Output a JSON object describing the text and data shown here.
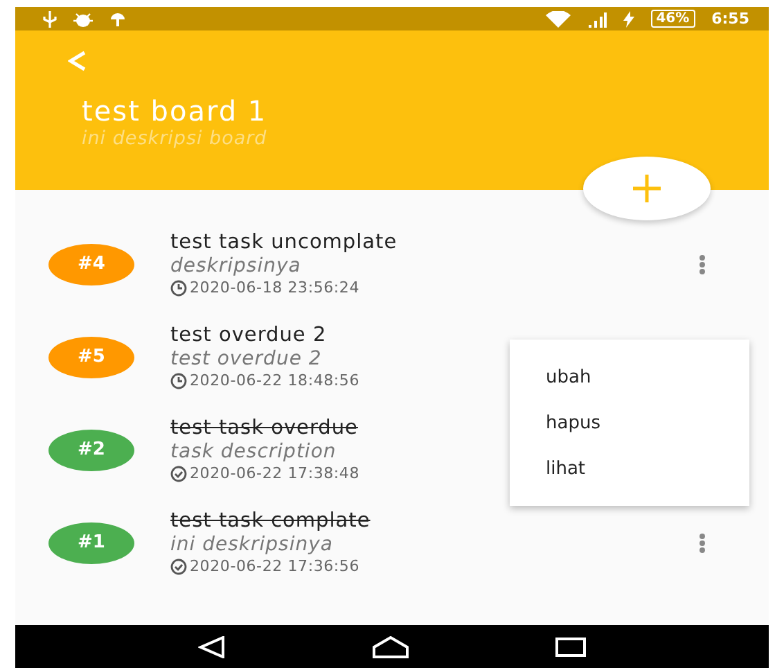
{
  "status_bar": {
    "battery": "46%",
    "time": "6:55"
  },
  "header": {
    "title": "test board 1",
    "description": "ini deskripsi board"
  },
  "tasks": [
    {
      "number": "#4",
      "title": "test task uncomplate",
      "description": "deskripsinya",
      "date": "2020-06-18 23:56:24",
      "done": false,
      "menu_button": true
    },
    {
      "number": "#5",
      "title": "test overdue 2",
      "description": "test overdue 2",
      "date": "2020-06-22 18:48:56",
      "done": false,
      "menu_button": false
    },
    {
      "number": "#2",
      "title": "test task overdue",
      "description": "task description",
      "date": "2020-06-22 17:38:48",
      "done": true,
      "menu_button": false
    },
    {
      "number": "#1",
      "title": "test task complate",
      "description": "ini deskripsinya",
      "date": "2020-06-22 17:36:56",
      "done": true,
      "menu_button": true
    }
  ],
  "popup_menu": [
    "ubah",
    "hapus",
    "lihat"
  ]
}
